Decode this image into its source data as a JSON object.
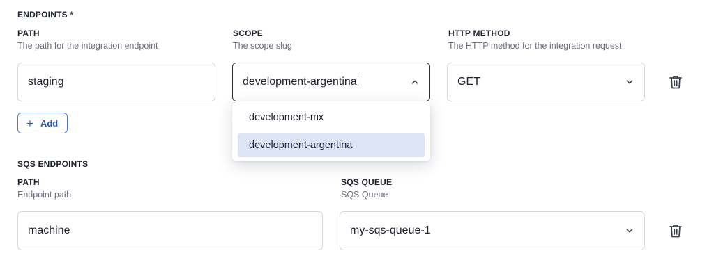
{
  "endpoints": {
    "title": "ENDPOINTS *",
    "columns": {
      "path": {
        "label": "PATH",
        "help": "The path for the integration endpoint"
      },
      "scope": {
        "label": "SCOPE",
        "help": "The scope slug"
      },
      "method": {
        "label": "HTTP METHOD",
        "help": "The HTTP method for the integration request"
      }
    },
    "row": {
      "path_value": "staging",
      "scope_value": "development-argentina",
      "method_value": "GET"
    },
    "scope_options": [
      {
        "label": "development-mx",
        "selected": false
      },
      {
        "label": "development-argentina",
        "selected": true
      }
    ],
    "add_label": "Add"
  },
  "sqs": {
    "title": "SQS ENDPOINTS",
    "columns": {
      "path": {
        "label": "PATH",
        "help": "Endpoint path"
      },
      "queue": {
        "label": "SQS QUEUE",
        "help": "SQS Queue"
      }
    },
    "row": {
      "path_value": "machine",
      "queue_value": "my-sqs-queue-1"
    }
  },
  "icons": {
    "delete": "trash-icon",
    "expand": "chevron-down-icon",
    "collapse": "chevron-up-icon",
    "add": "plus-icon"
  },
  "colors": {
    "accent": "#2c5bb8",
    "selected_option_bg": "#dde4f5",
    "border": "#d5d8de"
  }
}
